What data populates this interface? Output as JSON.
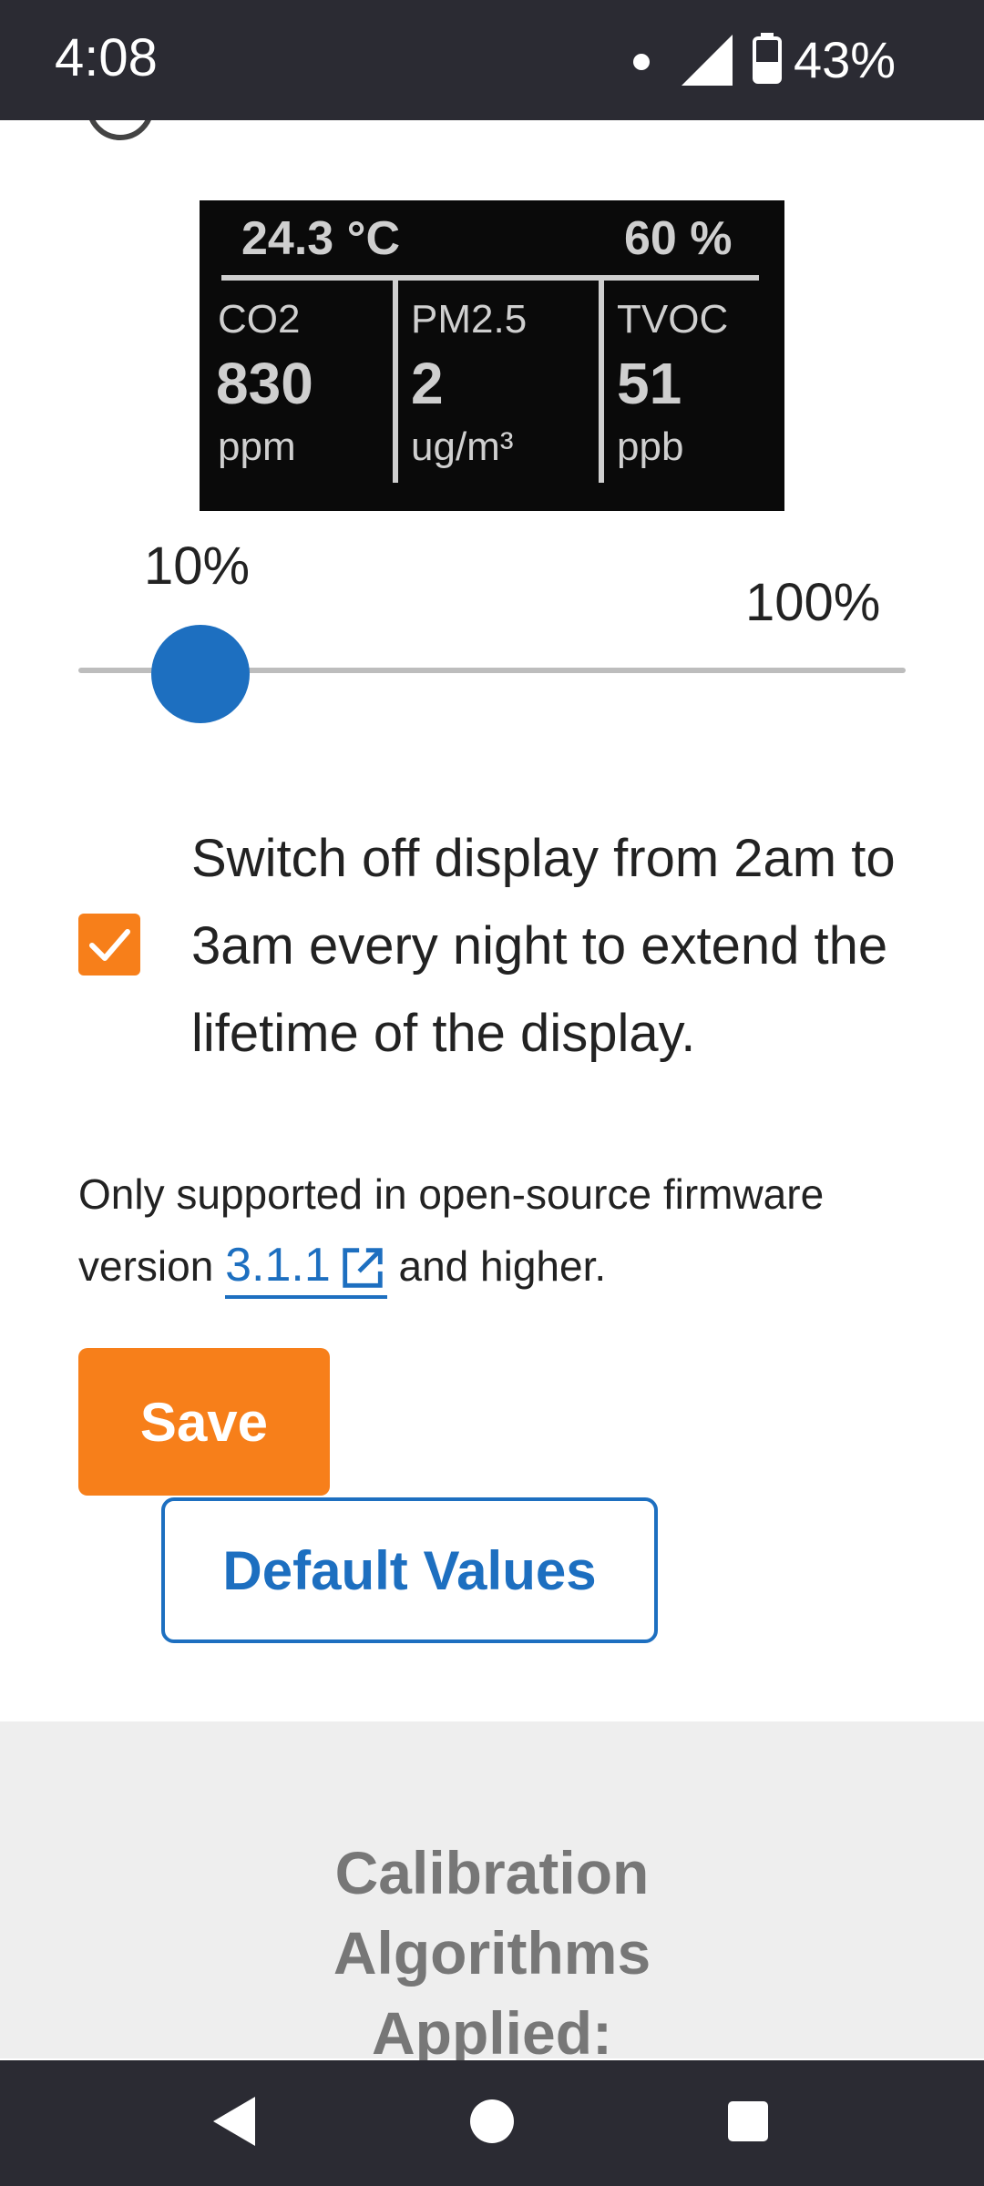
{
  "status_bar": {
    "time": "4:08",
    "battery": "43%"
  },
  "display_preview": {
    "temperature": "24.3 °C",
    "humidity": "60 %",
    "co2_label": "CO2",
    "co2_value": "830",
    "co2_unit": "ppm",
    "pm_label": "PM2.5",
    "pm_value": "2",
    "pm_unit": "ug/m³",
    "tvoc_label": "TVOC",
    "tvoc_value": "51",
    "tvoc_unit": "ppb"
  },
  "brightness_slider": {
    "min_label": "10%",
    "max_label": "100%",
    "value_percent": 10
  },
  "night_off": {
    "checked": true,
    "text": "Switch off display from 2am to 3am every night to extend the lifetime of the display."
  },
  "note": {
    "prefix": "Only supported in open-source firmware version ",
    "link": "3.1.1",
    "suffix": " and higher."
  },
  "buttons": {
    "save": "Save",
    "defaults": "Default Values"
  },
  "calibration": {
    "title_line1": "Calibration",
    "title_line2": "Algorithms",
    "title_line3": "Applied:"
  },
  "colors": {
    "accent_orange": "#f77f1a",
    "accent_blue": "#1d6fc0"
  }
}
